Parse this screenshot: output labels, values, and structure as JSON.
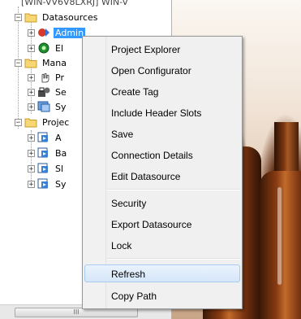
{
  "tree": {
    "header_text": "[WIN-VV6V8LXRJ] WIN-V",
    "items": [
      {
        "label": "Datasources"
      },
      {
        "label": "Admin"
      },
      {
        "label": "El"
      },
      {
        "label": "Mana"
      },
      {
        "label": "Pr"
      },
      {
        "label": "Se"
      },
      {
        "label": "Sy"
      },
      {
        "label": "Projec"
      },
      {
        "label": "A"
      },
      {
        "label": "Ba"
      },
      {
        "label": "Sl"
      },
      {
        "label": "Sy"
      }
    ],
    "scroll_label": "III"
  },
  "context_menu": {
    "items": [
      {
        "label": "Project Explorer"
      },
      {
        "label": "Open Configurator"
      },
      {
        "label": "Create Tag"
      },
      {
        "label": "Include Header Slots"
      },
      {
        "label": "Save"
      },
      {
        "label": "Connection Details"
      },
      {
        "label": "Edit Datasource"
      },
      {
        "label": "Security"
      },
      {
        "label": "Export Datasource"
      },
      {
        "label": "Lock"
      },
      {
        "label": "Refresh"
      },
      {
        "label": "Copy Path"
      }
    ],
    "highlighted_item": "Refresh"
  },
  "colors": {
    "selection": "#3399ff",
    "menu_highlight": "#d5e6f9",
    "menu_highlight_border": "#a8cbf1"
  }
}
